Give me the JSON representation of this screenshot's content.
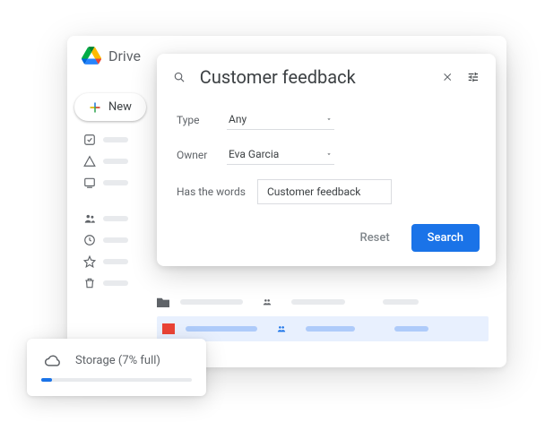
{
  "app": {
    "title": "Drive"
  },
  "sidebar": {
    "new_label": "New"
  },
  "search": {
    "query": "Customer feedback",
    "filters": {
      "type_label": "Type",
      "type_value": "Any",
      "owner_label": "Owner",
      "owner_value": "Eva Garcia",
      "words_label": "Has the words",
      "words_value": "Customer feedback"
    },
    "reset_label": "Reset",
    "search_label": "Search"
  },
  "storage": {
    "label": "Storage (7% full)",
    "percent": 7
  }
}
